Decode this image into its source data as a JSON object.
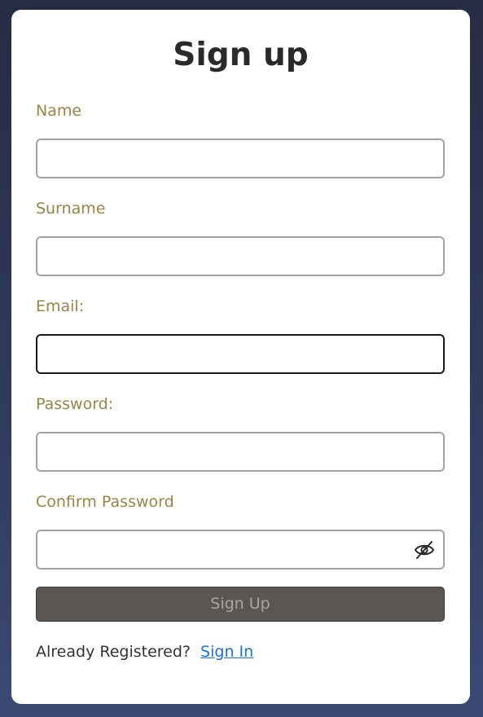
{
  "form": {
    "title": "Sign up",
    "fields": [
      {
        "label": "Name",
        "value": ""
      },
      {
        "label": "Surname",
        "value": ""
      },
      {
        "label": "Email:",
        "value": ""
      },
      {
        "label": "Password:",
        "value": ""
      },
      {
        "label": "Confirm Password",
        "value": ""
      }
    ],
    "submit_label": "Sign Up",
    "footer_text": "Already Registered?",
    "signin_link": "Sign In"
  },
  "icons": {
    "password_toggle": "eye-off-icon"
  },
  "colors": {
    "label": "#9a8448",
    "link": "#1f6fd8",
    "button_bg": "#5a5753",
    "button_text": "#a8a6a1",
    "card_bg": "#ffffff"
  }
}
